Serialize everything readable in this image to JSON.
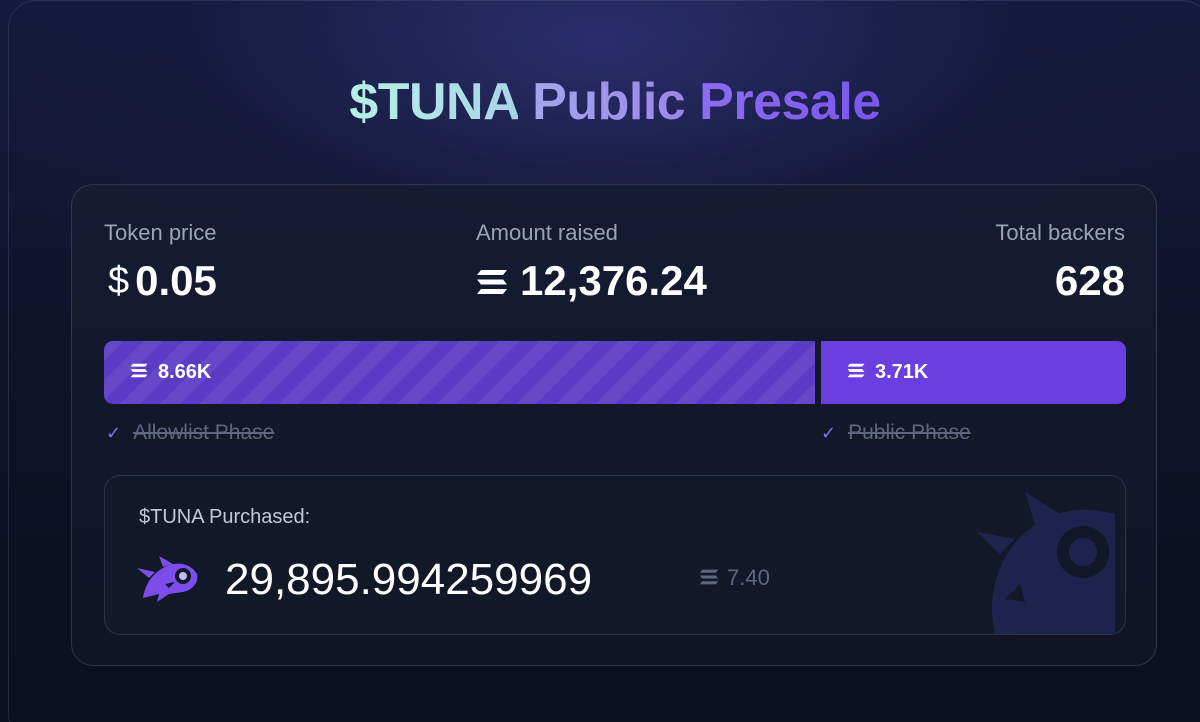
{
  "title": {
    "ticker": "$TUNA",
    "word1": "Public",
    "word2": "Presale"
  },
  "stats": {
    "token_price": {
      "label": "Token price",
      "currency_symbol": "$",
      "value": "0.05"
    },
    "amount_raised": {
      "label": "Amount raised",
      "currency_icon": "solana-icon",
      "value": "12,376.24"
    },
    "total_backers": {
      "label": "Total backers",
      "value": "628"
    }
  },
  "progress": {
    "allowlist": {
      "value": "8.66K",
      "amount": 8.66,
      "phase_label": "Allowlist Phase",
      "completed": true
    },
    "public": {
      "value": "3.71K",
      "amount": 3.71,
      "phase_label": "Public Phase",
      "completed": true
    }
  },
  "purchase": {
    "label": "$TUNA Purchased:",
    "amount": "29,895.994259969",
    "sol_value": "7.40",
    "logo_icon": "tuna-fish-icon",
    "watermark_icon": "tuna-fish-icon"
  },
  "colors": {
    "accent": "#6b3ee0",
    "accent_stripes": "#5a3bc4",
    "check": "#8a6cf0",
    "background": "#0c1120"
  }
}
